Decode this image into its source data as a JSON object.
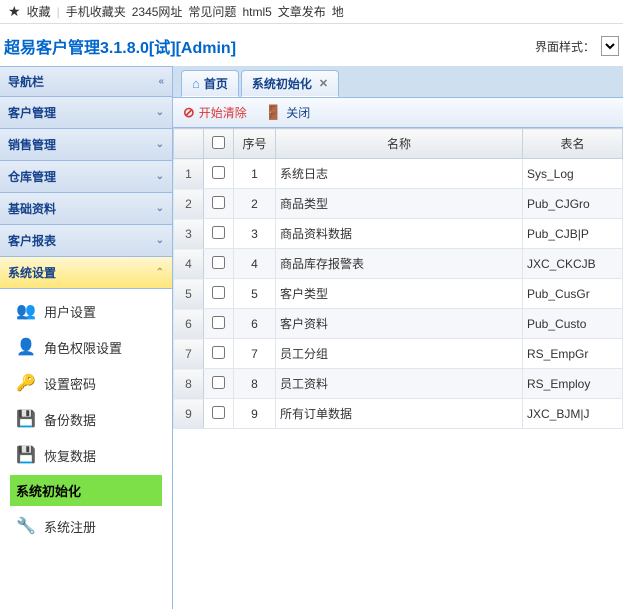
{
  "topbar": {
    "fav": "收藏",
    "item1": "手机收藏夹",
    "item2": "2345网址",
    "item3": "常见问题",
    "item4": "html5",
    "item5": "文章发布",
    "item6": "地"
  },
  "header": {
    "title": "超易客户管理3.1.8.0[试][Admin]",
    "style_label": "界面样式："
  },
  "sidebar": {
    "nav_title": "导航栏",
    "sections": [
      {
        "label": "客户管理"
      },
      {
        "label": "销售管理"
      },
      {
        "label": "仓库管理"
      },
      {
        "label": "基础资料"
      },
      {
        "label": "客户报表"
      },
      {
        "label": "系统设置"
      }
    ],
    "submenu": [
      {
        "label": "用户设置"
      },
      {
        "label": "角色权限设置"
      },
      {
        "label": "设置密码"
      },
      {
        "label": "备份数据"
      },
      {
        "label": "恢复数据"
      },
      {
        "label": "系统初始化"
      },
      {
        "label": "系统注册"
      }
    ]
  },
  "tabs": {
    "home": "首页",
    "init": "系统初始化"
  },
  "toolbar": {
    "clear": "开始清除",
    "close": "关闭"
  },
  "grid": {
    "headers": {
      "seq": "序号",
      "name": "名称",
      "table": "表名"
    },
    "rows": [
      {
        "n": "1",
        "seq": "1",
        "name": "系统日志",
        "tbl": "Sys_Log"
      },
      {
        "n": "2",
        "seq": "2",
        "name": "商品类型",
        "tbl": "Pub_CJGro"
      },
      {
        "n": "3",
        "seq": "3",
        "name": "商品资料数据",
        "tbl": "Pub_CJB|P"
      },
      {
        "n": "4",
        "seq": "4",
        "name": "商品库存报警表",
        "tbl": "JXC_CKCJB"
      },
      {
        "n": "5",
        "seq": "5",
        "name": "客户类型",
        "tbl": "Pub_CusGr"
      },
      {
        "n": "6",
        "seq": "6",
        "name": "客户资料",
        "tbl": "Pub_Custo"
      },
      {
        "n": "7",
        "seq": "7",
        "name": "员工分组",
        "tbl": "RS_EmpGr"
      },
      {
        "n": "8",
        "seq": "8",
        "name": "员工资料",
        "tbl": "RS_Employ"
      },
      {
        "n": "9",
        "seq": "9",
        "name": "所有订单数据",
        "tbl": "JXC_BJM|J"
      }
    ]
  }
}
